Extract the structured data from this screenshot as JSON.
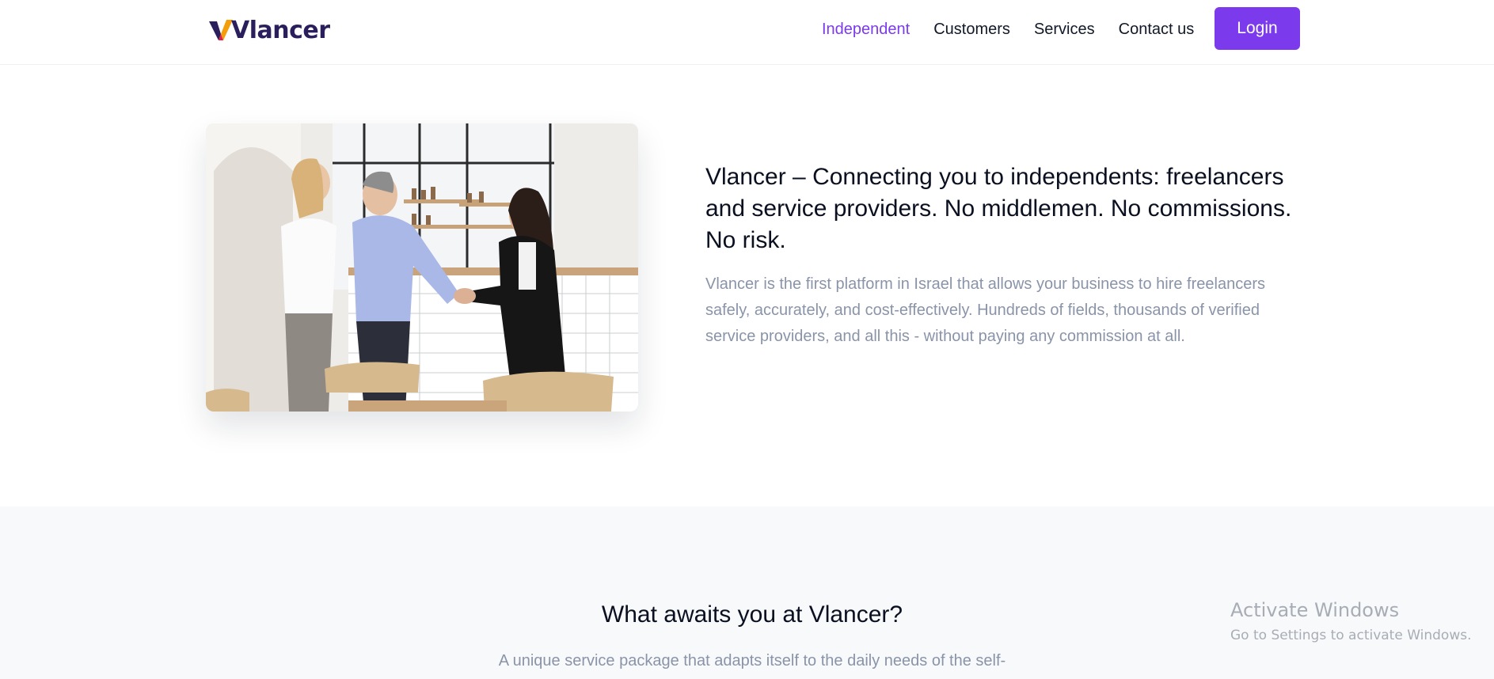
{
  "header": {
    "logo_text": "Vlancer",
    "nav": [
      {
        "label": "Independent",
        "active": true
      },
      {
        "label": "Customers"
      },
      {
        "label": "Services"
      },
      {
        "label": "Contact us"
      }
    ],
    "login_label": "Login"
  },
  "hero": {
    "title": "Vlancer – Connecting you to independents: freelancers and service providers. No middlemen. No commissions. No risk.",
    "description": "Vlancer is the first platform in Israel that allows your business to hire freelancers safely, accurately, and cost-effectively. Hundreds of fields, thousands of verified service providers, and all this - without paying any commission at all."
  },
  "features": {
    "title": "What awaits you at Vlancer?",
    "subtitle": "A unique service package that adapts itself to the daily needs of the self-"
  },
  "watermark": {
    "line1": "Activate Windows",
    "line2": "Go to Settings to activate Windows."
  },
  "colors": {
    "accent": "#7c3aed",
    "logo_v_orange": "#f59e0b",
    "logo_dark": "#2a1f5c",
    "muted_text": "#8a94a8",
    "section_bg": "#f8f9fb"
  }
}
